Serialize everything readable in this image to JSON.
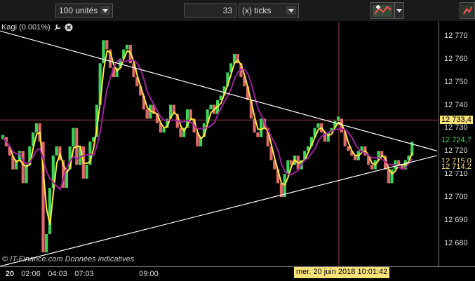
{
  "toolbar": {
    "volume_select": "100 unités",
    "ticks_value": "33",
    "ticks_unit_select": "(x) ticks"
  },
  "indicator": {
    "label": "Kagi (0.001%)"
  },
  "copyright": "© IT-Finance.com  Données indicatives",
  "crosshair_date": "mer. 20 juin 2018 10:01:42",
  "y_axis": {
    "ticks": [
      "12 770",
      "12 760",
      "12 750",
      "12 740",
      "12 730",
      "12 720",
      "12 710",
      "12 700",
      "12 690",
      "12 680"
    ],
    "labels": [
      {
        "text": "12 733,4",
        "bg": "#f7e27a",
        "fg": "#000"
      },
      {
        "text": "12 724,7",
        "bg": "#000",
        "fg": "#3ed45a"
      },
      {
        "text": "12 715,0",
        "bg": "#000",
        "fg": "#f7e27a"
      },
      {
        "text": "12 714,2",
        "bg": "#000",
        "fg": "#f7e27a"
      }
    ]
  },
  "x_axis": {
    "ticks": [
      {
        "text": "20",
        "bold": true
      },
      {
        "text": "02:06",
        "bold": false
      },
      {
        "text": "04:03",
        "bold": false
      },
      {
        "text": "07:03",
        "bold": false
      },
      {
        "text": "09:00",
        "bold": false
      }
    ]
  },
  "chart_data": {
    "type": "bar",
    "ylim": [
      12670,
      12776
    ],
    "kagi_close": [
      12726,
      12722,
      12718,
      12712,
      12716,
      12720,
      12706,
      12714,
      12722,
      12728,
      12732,
      12724,
      12676,
      12684,
      12704,
      12718,
      12722,
      12716,
      12704,
      12712,
      12722,
      12730,
      12714,
      12722,
      12708,
      12714,
      12724,
      12726,
      12740,
      12758,
      12768,
      12764,
      12756,
      12752,
      12756,
      12760,
      12764,
      12766,
      12758,
      12752,
      12748,
      12744,
      12738,
      12734,
      12740,
      12736,
      12732,
      12728,
      12730,
      12734,
      12740,
      12736,
      12730,
      12726,
      12730,
      12738,
      12734,
      12728,
      12722,
      12726,
      12732,
      12738,
      12740,
      12736,
      12742,
      12744,
      12748,
      12754,
      12758,
      12762,
      12758,
      12752,
      12748,
      12742,
      12734,
      12728,
      12726,
      12734,
      12730,
      12722,
      12716,
      12712,
      12706,
      12700,
      12710,
      12716,
      12714,
      12718,
      12712,
      12716,
      12720,
      12722,
      12726,
      12730,
      12732,
      12728,
      12724,
      12728,
      12730,
      12733,
      12734,
      12728,
      12722,
      12720,
      12718,
      12716,
      12720,
      12722,
      12718,
      12714,
      12712,
      12716,
      12720,
      12718,
      12712,
      12706,
      12712,
      12716,
      12714,
      12712,
      12716,
      12718,
      12724
    ],
    "bull_color": "#3ed45a",
    "bear_color": "#e06a6a",
    "ma_colors": [
      "#ffeb3b",
      "#a020a0"
    ],
    "hline": 12733.4,
    "trend_upper": [
      [
        0,
        12772
      ],
      [
        623,
        12720
      ]
    ],
    "trend_lower": [
      [
        0,
        12670
      ],
      [
        623,
        12718
      ]
    ]
  }
}
